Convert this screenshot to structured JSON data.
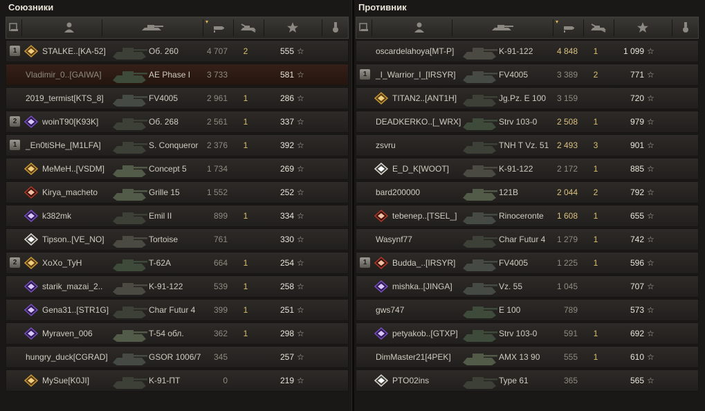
{
  "allies": {
    "title": "Союзники",
    "rows": [
      {
        "platoon": "1",
        "badge": "gold",
        "name": "STALKE..[KA-52]",
        "tank": "Об. 260",
        "damage": "4 707",
        "kills": "2",
        "xp": "555",
        "dead": false,
        "hi": false
      },
      {
        "platoon": "",
        "badge": "",
        "name": "Vladimir_0..[GAIWA]",
        "tank": "AE Phase I",
        "damage": "3 733",
        "kills": "",
        "xp": "581",
        "dead": true,
        "hi": false
      },
      {
        "platoon": "",
        "badge": "",
        "name": "2019_termist[KTS_8]",
        "tank": "FV4005",
        "damage": "2 961",
        "kills": "1",
        "xp": "286",
        "dead": false,
        "hi": false
      },
      {
        "platoon": "2",
        "badge": "purple",
        "name": "woinT90[K93K]",
        "tank": "Об. 268",
        "damage": "2 561",
        "kills": "1",
        "xp": "337",
        "dead": false,
        "hi": false
      },
      {
        "platoon": "1",
        "badge": "",
        "name": "_En0tiSHe_[M1LFA]",
        "tank": "S. Conqueror",
        "damage": "2 376",
        "kills": "1",
        "xp": "392",
        "dead": false,
        "hi": false
      },
      {
        "platoon": "",
        "badge": "gold",
        "name": "MeMeH..[VSDM]",
        "tank": "Concept 5",
        "damage": "1 734",
        "kills": "",
        "xp": "269",
        "dead": false,
        "hi": false
      },
      {
        "platoon": "",
        "badge": "red",
        "name": "Kirya_macheto",
        "tank": "Grille 15",
        "damage": "1 552",
        "kills": "",
        "xp": "252",
        "dead": false,
        "hi": false
      },
      {
        "platoon": "",
        "badge": "purple",
        "name": "k382mk",
        "tank": "Emil II",
        "damage": "899",
        "kills": "1",
        "xp": "334",
        "dead": false,
        "hi": false
      },
      {
        "platoon": "",
        "badge": "white",
        "name": "Tipson..[VE_NO]",
        "tank": "Tortoise",
        "damage": "761",
        "kills": "",
        "xp": "330",
        "dead": false,
        "hi": false
      },
      {
        "platoon": "2",
        "badge": "gold",
        "name": "XoXo_TyH",
        "tank": "T-62A",
        "damage": "664",
        "kills": "1",
        "xp": "254",
        "dead": false,
        "hi": false
      },
      {
        "platoon": "",
        "badge": "purple",
        "name": "starik_mazai_2..",
        "tank": "K-91-122",
        "damage": "539",
        "kills": "1",
        "xp": "258",
        "dead": false,
        "hi": false
      },
      {
        "platoon": "",
        "badge": "purple",
        "name": "Gena31..[STR1G]",
        "tank": "Char Futur 4",
        "damage": "399",
        "kills": "1",
        "xp": "251",
        "dead": false,
        "hi": false
      },
      {
        "platoon": "",
        "badge": "purple",
        "name": "Myraven_006",
        "tank": "T-54 обл.",
        "damage": "362",
        "kills": "1",
        "xp": "298",
        "dead": false,
        "hi": false
      },
      {
        "platoon": "",
        "badge": "",
        "name": "hungry_duck[CGRAD]",
        "tank": "GSOR 1006/7",
        "damage": "345",
        "kills": "",
        "xp": "257",
        "dead": false,
        "hi": false
      },
      {
        "platoon": "",
        "badge": "gold",
        "name": "MySue[K0JI]",
        "tank": "K-91-ПТ",
        "damage": "0",
        "kills": "",
        "xp": "219",
        "dead": false,
        "hi": false
      }
    ]
  },
  "enemies": {
    "title": "Противник",
    "rows": [
      {
        "platoon": "",
        "badge": "",
        "name": "oscardelahoya[MT-P]",
        "tank": "K-91-122",
        "damage": "4 848",
        "kills": "1",
        "xp": "1 099",
        "dead": false,
        "hi": true
      },
      {
        "platoon": "1",
        "badge": "",
        "name": "_I_Warrior_I_[IRSYR]",
        "tank": "FV4005",
        "damage": "3 389",
        "kills": "2",
        "xp": "771",
        "dead": false,
        "hi": false
      },
      {
        "platoon": "",
        "badge": "gold",
        "name": "TITAN2..[ANT1H]",
        "tank": "Jg.Pz. E 100",
        "damage": "3 159",
        "kills": "",
        "xp": "720",
        "dead": false,
        "hi": false
      },
      {
        "platoon": "",
        "badge": "",
        "name": "DEADKERKO..[_WRX]",
        "tank": "Strv 103-0",
        "damage": "2 508",
        "kills": "1",
        "xp": "979",
        "dead": false,
        "hi": true
      },
      {
        "platoon": "",
        "badge": "",
        "name": "zsvru",
        "tank": "TNH T Vz. 51",
        "damage": "2 493",
        "kills": "3",
        "xp": "901",
        "dead": false,
        "hi": true
      },
      {
        "platoon": "",
        "badge": "white",
        "name": "E_D_K[WOOT]",
        "tank": "K-91-122",
        "damage": "2 172",
        "kills": "1",
        "xp": "885",
        "dead": false,
        "hi": false
      },
      {
        "platoon": "",
        "badge": "",
        "name": "bard200000",
        "tank": "121B",
        "damage": "2 044",
        "kills": "2",
        "xp": "792",
        "dead": false,
        "hi": true
      },
      {
        "platoon": "",
        "badge": "red",
        "name": "tebenep..[TSEL_]",
        "tank": "Rinoceronte",
        "damage": "1 608",
        "kills": "1",
        "xp": "655",
        "dead": false,
        "hi": true
      },
      {
        "platoon": "",
        "badge": "",
        "name": "Wasynf77",
        "tank": "Char Futur 4",
        "damage": "1 279",
        "kills": "1",
        "xp": "742",
        "dead": false,
        "hi": false
      },
      {
        "platoon": "1",
        "badge": "red",
        "name": "Budda_..[IRSYR]",
        "tank": "FV4005",
        "damage": "1 225",
        "kills": "1",
        "xp": "596",
        "dead": false,
        "hi": false
      },
      {
        "platoon": "",
        "badge": "purple",
        "name": "mishka..[JINGA]",
        "tank": "Vz. 55",
        "damage": "1 045",
        "kills": "",
        "xp": "707",
        "dead": false,
        "hi": false
      },
      {
        "platoon": "",
        "badge": "",
        "name": "gws747",
        "tank": "E 100",
        "damage": "789",
        "kills": "",
        "xp": "573",
        "dead": false,
        "hi": false
      },
      {
        "platoon": "",
        "badge": "purple",
        "name": "petyakob..[GTXP]",
        "tank": "Strv 103-0",
        "damage": "591",
        "kills": "1",
        "xp": "692",
        "dead": false,
        "hi": false
      },
      {
        "platoon": "",
        "badge": "",
        "name": "DimMaster21[4PEK]",
        "tank": "AMX 13 90",
        "damage": "555",
        "kills": "1",
        "xp": "610",
        "dead": false,
        "hi": false
      },
      {
        "platoon": "",
        "badge": "white",
        "name": "PTO02ins",
        "tank": "Type 61",
        "damage": "365",
        "kills": "",
        "xp": "565",
        "dead": false,
        "hi": false
      }
    ]
  },
  "headers": {
    "icons": [
      "squad-icon",
      "player-icon",
      "vehicle-icon",
      "damage-icon",
      "kills-icon",
      "xp-star-icon",
      "medal-icon"
    ],
    "sort_mark": "▾"
  },
  "colors": {
    "highlight_damage": "#d9c080",
    "kills": "#d9c070",
    "dead_row": "#352018"
  }
}
